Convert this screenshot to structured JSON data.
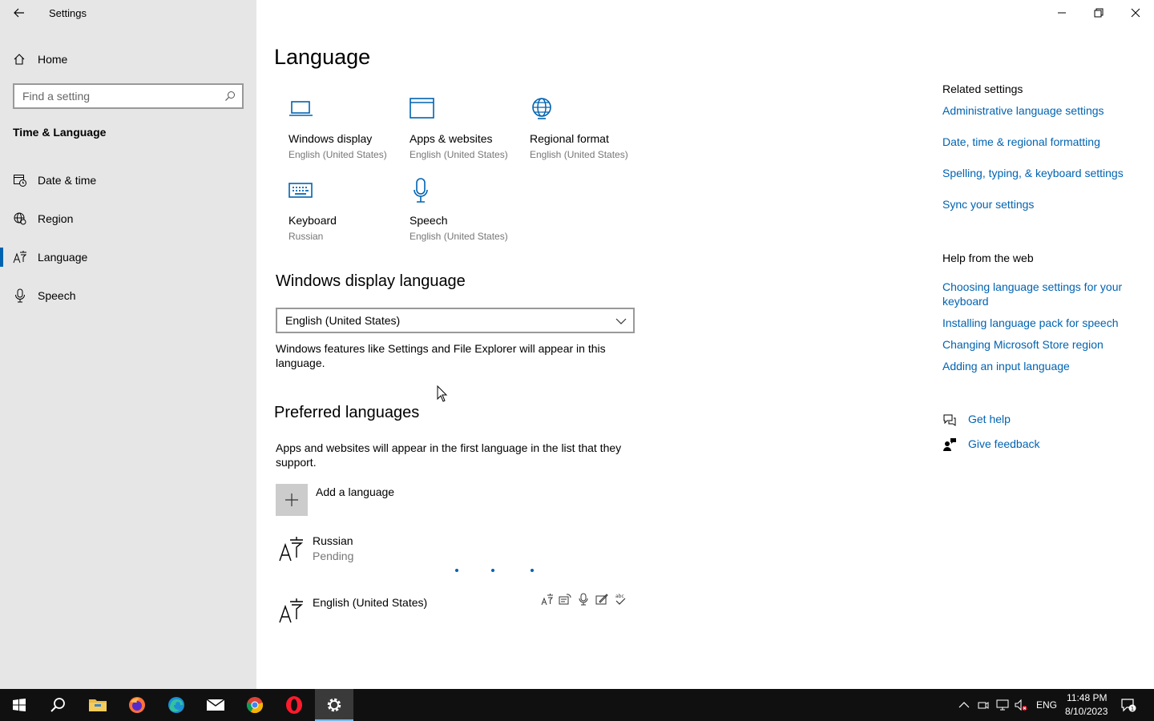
{
  "window": {
    "title": "Settings"
  },
  "sidebar": {
    "home_label": "Home",
    "search_placeholder": "Find a setting",
    "section_title": "Time & Language",
    "items": [
      {
        "label": "Date & time",
        "icon": "calendar-clock-icon"
      },
      {
        "label": "Region",
        "icon": "globe-icon"
      },
      {
        "label": "Language",
        "icon": "language-icon",
        "selected": true
      },
      {
        "label": "Speech",
        "icon": "microphone-icon"
      }
    ]
  },
  "main": {
    "title": "Language",
    "tiles": [
      {
        "name": "Windows display",
        "sub": "English (United States)",
        "icon": "laptop-icon"
      },
      {
        "name": "Apps & websites",
        "sub": "English (United States)",
        "icon": "window-icon"
      },
      {
        "name": "Regional format",
        "sub": "English (United States)",
        "icon": "globe-format-icon"
      },
      {
        "name": "Keyboard",
        "sub": "Russian",
        "icon": "keyboard-icon"
      },
      {
        "name": "Speech",
        "sub": "English (United States)",
        "icon": "microphone-icon"
      }
    ],
    "display_language": {
      "heading": "Windows display language",
      "selected": "English (United States)",
      "description": "Windows features like Settings and File Explorer will appear in this language."
    },
    "preferred": {
      "heading": "Preferred languages",
      "description": "Apps and websites will appear in the first language in the list that they support.",
      "add_label": "Add a language",
      "languages": [
        {
          "name": "Russian",
          "status": "Pending"
        },
        {
          "name": "English (United States)",
          "status": ""
        }
      ],
      "feature_icons": [
        "language-pack-icon",
        "text-to-speech-icon",
        "speech-recognition-icon",
        "handwriting-icon",
        "spellcheck-icon"
      ]
    }
  },
  "related": {
    "heading": "Related settings",
    "links": [
      "Administrative language settings",
      "Date, time & regional formatting",
      "Spelling, typing, & keyboard settings",
      "Sync your settings"
    ]
  },
  "help": {
    "heading": "Help from the web",
    "links": [
      "Choosing language settings for your keyboard",
      "Installing language pack for speech",
      "Changing Microsoft Store region",
      "Adding an input language"
    ],
    "get_help": "Get help",
    "give_feedback": "Give feedback"
  },
  "taskbar": {
    "apps": [
      "start-icon",
      "search-icon",
      "file-explorer-icon",
      "firefox-icon",
      "edge-icon",
      "mail-icon",
      "chrome-icon",
      "opera-icon",
      "settings-icon"
    ],
    "lang": "ENG",
    "time": "11:48 PM",
    "date": "8/10/2023",
    "notification_count": "1"
  },
  "colors": {
    "accent": "#0063b1",
    "sidebar_bg": "#e6e6e6",
    "taskbar_bg": "#101010"
  }
}
